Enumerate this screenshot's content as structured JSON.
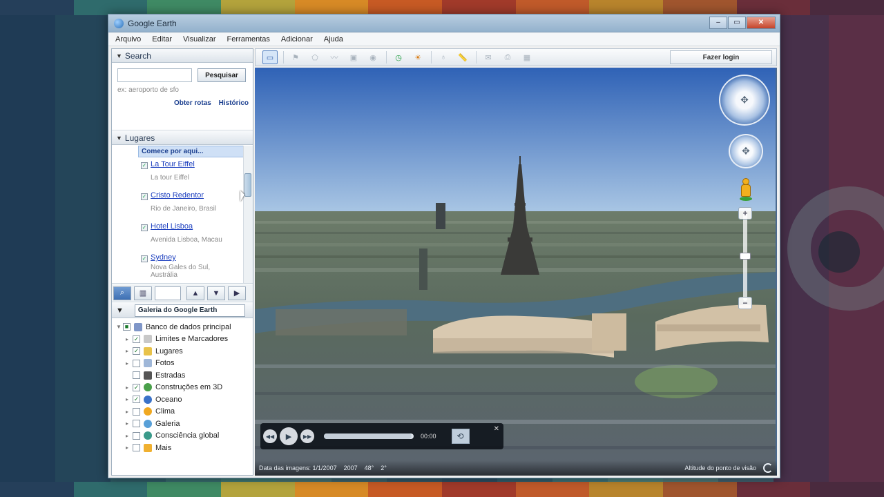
{
  "window": {
    "title": "Google Earth",
    "controls": {
      "minimize": "–",
      "maximize": "▭",
      "close": "✕"
    }
  },
  "menu": [
    "Arquivo",
    "Editar",
    "Visualizar",
    "Ferramentas",
    "Adicionar",
    "Ajuda"
  ],
  "toolbar": {
    "signin_label": "Fazer login"
  },
  "search": {
    "header": "Search",
    "input_value": "",
    "button_label": "Pesquisar",
    "example": "ex: aeroporto de sfo",
    "links": [
      "Obter rotas",
      "Histórico"
    ]
  },
  "places": {
    "header": "Lugares",
    "first_item": "Comece por aqui...",
    "items": [
      {
        "label": "La Tour Eiffel",
        "desc": "La tour Eiffel"
      },
      {
        "label": "Cristo Redentor",
        "desc": "Rio de Janeiro, Brasil"
      },
      {
        "label": "Hotel Lisboa",
        "desc": "Avenida Lisboa, Macau"
      },
      {
        "label": "Sydney",
        "desc": "Nova Gales do Sul, Austrália"
      }
    ]
  },
  "layers": {
    "gallery_label": "Galeria do Google Earth",
    "items": [
      {
        "label": "Banco de dados principal",
        "checked": true,
        "color": "#7f96c8"
      },
      {
        "label": "Limites e Marcadores",
        "checked": true,
        "color": "#c8c8c8"
      },
      {
        "label": "Lugares",
        "checked": true,
        "color": "#e8c24a"
      },
      {
        "label": "Fotos",
        "checked": false,
        "color": "#9fb7d8"
      },
      {
        "label": "Estradas",
        "checked": false,
        "color": "#555555"
      },
      {
        "label": "Construções em 3D",
        "checked": true,
        "color": "#4aa04a"
      },
      {
        "label": "Oceano",
        "checked": true,
        "color": "#3a72c8"
      },
      {
        "label": "Clima",
        "checked": false,
        "color": "#f0a820"
      },
      {
        "label": "Galeria",
        "checked": false,
        "color": "#58a0d8"
      },
      {
        "label": "Consciência global",
        "checked": false,
        "color": "#3a9a8a"
      },
      {
        "label": "Mais",
        "checked": false,
        "color": "#f0b030"
      }
    ]
  },
  "tour_player": {
    "time": "00:00",
    "progress": 0.98
  },
  "status": {
    "imagery": "Data das imagens: 1/1/2007",
    "year": "2007",
    "lat": "48°",
    "lon": "2°",
    "eye_alt": "Altitude do ponto de visão"
  },
  "colors": {
    "sky_top": "#2f62b6",
    "sky_bottom": "#a9c6e4",
    "city": "#6a7a68",
    "river": "#4e6e80"
  }
}
